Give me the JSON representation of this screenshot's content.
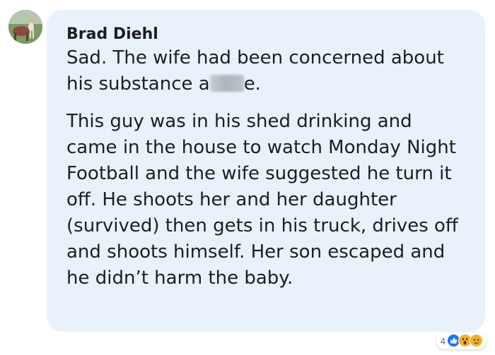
{
  "comment": {
    "author": "Brad Diehl",
    "paragraph1_before": "Sad. The wife had been concerned about his substance a",
    "paragraph1_after": "e.",
    "paragraph2": "This guy was in his shed drinking and came in the house to watch Monday Night Football and the wife suggested he turn it off. He shoots her and her daughter (survived) then gets in his truck, drives off and shoots himself. Her son escaped and he didn’t harm the baby."
  },
  "reactions": {
    "count": "4",
    "icons": [
      "like-icon",
      "wow-icon",
      "sad-icon"
    ]
  },
  "colors": {
    "bubble": "#e9f2fb",
    "text": "#1c1e21",
    "like": "#1877f2",
    "wow_sad": "#f7b125"
  }
}
